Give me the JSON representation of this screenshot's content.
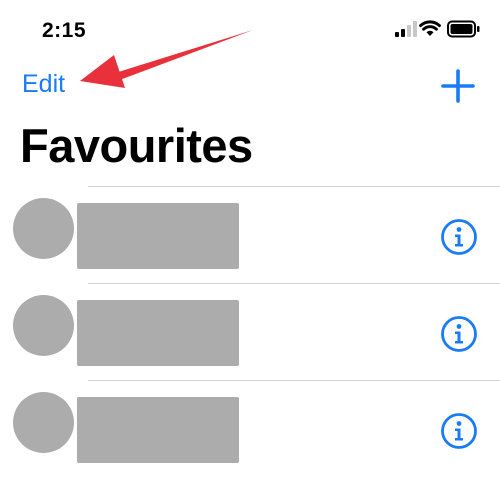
{
  "status_bar": {
    "time": "2:15",
    "icons": [
      "cellular-signal-icon",
      "wifi-icon",
      "battery-icon"
    ]
  },
  "nav": {
    "edit_label": "Edit",
    "add_icon": "plus-icon"
  },
  "title": "Favourites",
  "favourites": [
    {
      "avatar": "redacted",
      "name": "redacted",
      "info_icon": "info-icon"
    },
    {
      "avatar": "redacted",
      "name": "redacted",
      "info_icon": "info-icon"
    },
    {
      "avatar": "redacted",
      "name": "redacted",
      "info_icon": "info-icon"
    }
  ],
  "colors": {
    "accent": "#1a7cf5",
    "annotation_arrow": "#e8313a",
    "placeholder": "#acacac",
    "separator": "#d4d4d6"
  }
}
